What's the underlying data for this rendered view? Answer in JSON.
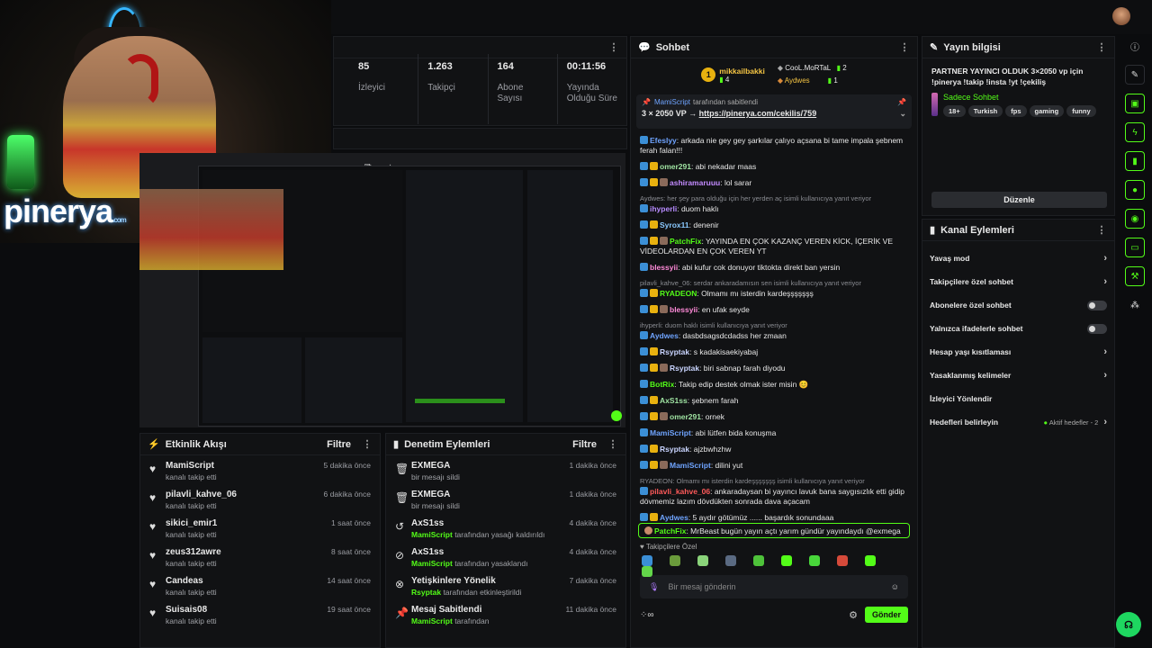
{
  "stats": [
    {
      "value": "85",
      "label": "İzleyici"
    },
    {
      "value": "1.263",
      "label": "Takipçi"
    },
    {
      "value": "164",
      "label": "Abone Sayısı"
    },
    {
      "value": "00:11:56",
      "label": "Yayında Olduğu Süre"
    }
  ],
  "webcam": {
    "logo": "pinerya",
    "logo_sub": ".com"
  },
  "activity": {
    "title": "Etkinlik Akışı",
    "filter": "Filtre",
    "items": [
      {
        "name": "MamiScript",
        "sub": "kanalı takip etti",
        "time": "5 dakika önce"
      },
      {
        "name": "pilavli_kahve_06",
        "sub": "kanalı takip etti",
        "time": "6 dakika önce"
      },
      {
        "name": "sikici_emir1",
        "sub": "kanalı takip etti",
        "time": "1 saat önce"
      },
      {
        "name": "zeus312awre",
        "sub": "kanalı takip etti",
        "time": "8 saat önce"
      },
      {
        "name": "Candeas",
        "sub": "kanalı takip etti",
        "time": "14 saat önce"
      },
      {
        "name": "Suisais08",
        "sub": "kanalı takip etti",
        "time": "19 saat önce"
      }
    ]
  },
  "moderation": {
    "title": "Denetim Eylemleri",
    "filter": "Filtre",
    "items": [
      {
        "icon": "trash-icon",
        "glyph": "🗑",
        "name": "EXMEGA",
        "actor": "",
        "sub": "bir mesajı sildi",
        "time": "1 dakika önce"
      },
      {
        "icon": "trash-icon",
        "glyph": "🗑",
        "name": "EXMEGA",
        "actor": "",
        "sub": "bir mesajı sildi",
        "time": "1 dakika önce"
      },
      {
        "icon": "undo-icon",
        "glyph": "↺",
        "name": "AxS1ss",
        "actor": "MamiScript",
        "sub": " tarafından yasağı kaldırıldı",
        "time": "4 dakika önce"
      },
      {
        "icon": "ban-icon",
        "glyph": "⊘",
        "name": "AxS1ss",
        "actor": "MamiScript",
        "sub": " tarafından yasaklandı",
        "time": "4 dakika önce"
      },
      {
        "icon": "no-icon",
        "glyph": "⊗",
        "name": "Yetişkinlere Yönelik",
        "actor": "Rsyptak",
        "sub": " tarafından etkinleştirildi",
        "time": "7 dakika önce"
      },
      {
        "icon": "pin-icon",
        "glyph": "📌",
        "name": "Mesaj Sabitlendi",
        "actor": "MamiScript",
        "sub": " tarafından",
        "time": "11 dakika önce"
      }
    ]
  },
  "chat": {
    "title": "Sohbet",
    "leaders": [
      {
        "rank": "1",
        "name": "mikkailbakki",
        "count": "4"
      },
      {
        "rank": "",
        "name": "CooL.MoRTaL",
        "count": "2"
      },
      {
        "rank": "",
        "name": "Aydwes",
        "count": "1"
      }
    ],
    "pinned_by": "MamiScript",
    "pinned_suffix": "tarafından sabitlendi",
    "pinned_text": "3 × 2050 VP → ",
    "pinned_link": "https://pinerya.com/cekilis/759",
    "messages": [
      {
        "reply": "",
        "user": "Efeslyy",
        "color": "#6fa4ff",
        "text": ": arkada nie gey gey şarkılar çalıyo açsana bi tame impala şebnem ferah falan!!!"
      },
      {
        "reply": "",
        "user": "omer291",
        "color": "#9fe3a2",
        "text": ": abi nekadar maas"
      },
      {
        "reply": "",
        "user": "ashiramaruuu",
        "color": "#c38bff",
        "text": ": lol sarar"
      },
      {
        "reply": "Aydwes: her şey para olduğu için her yerden aç isimli kullanıcıya yanıt veriyor",
        "user": "ihyperli",
        "color": "#b78bff",
        "text": ": duom haklı"
      },
      {
        "reply": "",
        "user": "Syrox11",
        "color": "#8ac9ff",
        "text": ": denenir"
      },
      {
        "reply": "",
        "user": "PatchFix",
        "color": "#53fc18",
        "text": ": YAYINDA EN ÇOK KAZANÇ VEREN KİCK, İÇERİK VE VİDEOLARDAN EN ÇOK VEREN YT"
      },
      {
        "reply": "",
        "user": "blessyii",
        "color": "#ff8ad8",
        "text": ": abi kufur cok donuyor tiktokta direkt ban yersin"
      },
      {
        "reply": "pilavli_kahve_06: serdar ankaradamısın sen isimli kullanıcıya yanıt veriyor",
        "user": "RYADEON",
        "color": "#53fc18",
        "text": ": Olmamı mı isterdin kardeşşşşşşş"
      },
      {
        "reply": "",
        "user": "blessyii",
        "color": "#ff8ad8",
        "text": ": en ufak seyde"
      },
      {
        "reply": "ihyperli: duom haklı isimli kullanıcıya yanıt veriyor",
        "user": "Aydwes",
        "color": "#6fa4ff",
        "text": ": dasbdsagsdcdadss her zmaan"
      },
      {
        "reply": "",
        "user": "Rsyptak",
        "color": "#c9d4ff",
        "text": ": s kadakisaekiyabaj"
      },
      {
        "reply": "",
        "user": "Rsyptak",
        "color": "#c9d4ff",
        "text": ": biri sabnap farah diyodu"
      },
      {
        "reply": "",
        "user": "BotRix",
        "color": "#53fc18",
        "text": ": Takip edip destek olmak ister misin 😊"
      },
      {
        "reply": "",
        "user": "AxS1ss",
        "color": "#9fe3a2",
        "text": ": şebnem farah"
      },
      {
        "reply": "",
        "user": "omer291",
        "color": "#9fe3a2",
        "text": ": ornek"
      },
      {
        "reply": "",
        "user": "MamiScript",
        "color": "#6fa4ff",
        "text": ": abi lütfen bida konuşma"
      },
      {
        "reply": "",
        "user": "Rsyptak",
        "color": "#c9d4ff",
        "text": ": ajzbwhzhw"
      },
      {
        "reply": "",
        "user": "MamiScript",
        "color": "#6fa4ff",
        "text": ": dilini yut"
      },
      {
        "reply": "RYADEON: Olmamı mı isterdin kardeşşşşşşş isimli kullanıcıya yanıt veriyor",
        "user": "pilavli_kahve_06",
        "color": "#ff5a5a",
        "text": ": ankaradaysan bi yayıncı lavuk bana saygısızlık etti gidip dövmemiz lazım dövdükten sonrada dava açacam"
      },
      {
        "reply": "",
        "user": "Aydwes",
        "color": "#6fa4ff",
        "text": ": 5 aydır götümüz ...... başardık sonundaaa"
      }
    ],
    "highlight": {
      "user": "PatchFix",
      "text": ": MrBeast bugün yayın açtı yarım gündür yayındaydı @exmega"
    },
    "followers_only": "Takipçilere Özel",
    "input_placeholder": "Bir mesaj gönderin",
    "send": "Gönder"
  },
  "stream_info": {
    "title": "Yayın bilgisi",
    "stream_title": "PARTNER YAYINCI OLDUK 3×2050 vp için !pinerya !takip !insta !yt !çekiliş",
    "category": "Sadece Sohbet",
    "tags": [
      "18+",
      "Turkish",
      "fps",
      "gaming",
      "funny"
    ],
    "edit": "Düzenle"
  },
  "channel_actions": {
    "title": "Kanal Eylemleri",
    "items": [
      {
        "label": "Yavaş mod",
        "control": "chevron",
        "extra": ""
      },
      {
        "label": "Takipçilere özel sohbet",
        "control": "chevron",
        "extra": ""
      },
      {
        "label": "Abonelere özel sohbet",
        "control": "toggle",
        "extra": ""
      },
      {
        "label": "Yalnızca ifadelerle sohbet",
        "control": "toggle",
        "extra": ""
      },
      {
        "label": "Hesap yaşı kısıtlaması",
        "control": "chevron",
        "extra": ""
      },
      {
        "label": "Yasaklanmış kelimeler",
        "control": "chevron",
        "extra": ""
      },
      {
        "label": "İzleyici Yönlendir",
        "control": "none",
        "extra": ""
      },
      {
        "label": "Hedefleri belirleyin",
        "control": "chevron",
        "extra": "Aktif hedefler - 2"
      }
    ]
  },
  "colors": {
    "accent": "#53fc18",
    "link": "#6fa4ff"
  }
}
